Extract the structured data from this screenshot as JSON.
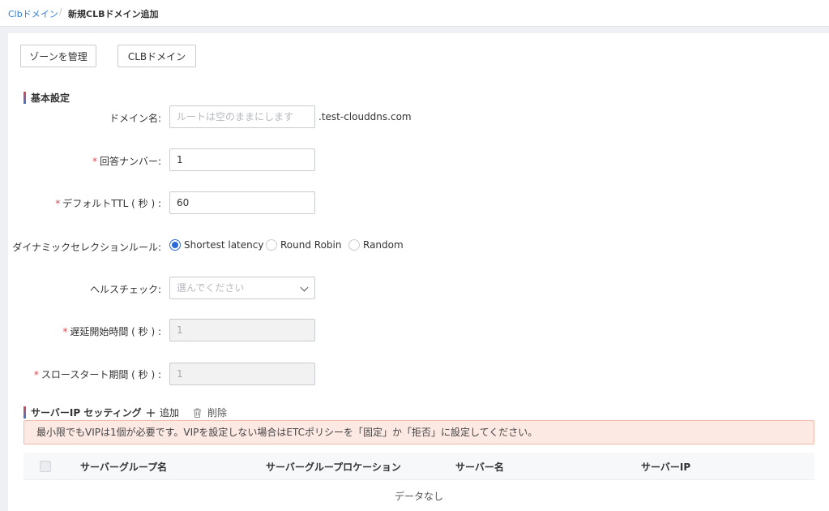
{
  "breadcrumb": {
    "parent": "Clbドメイン",
    "separator": "/",
    "current": "新規CLBドメイン追加"
  },
  "top_buttons": {
    "manage_zone": "ゾーンを管理",
    "clb_domain": "CLBドメイン"
  },
  "basic_settings": {
    "title": "基本設定",
    "domain_name": {
      "label": "ドメイン名:",
      "placeholder": "ルートは空のままにします",
      "value": "",
      "suffix": ".test-clouddns.com"
    },
    "answer_number": {
      "required": "*",
      "label": "回答ナンバー:",
      "value": "1"
    },
    "default_ttl": {
      "required": "*",
      "label": "デフォルトTTL ( 秒 ) :",
      "value": "60"
    },
    "dynamic_rule": {
      "label": "ダイナミックセレクションルール:",
      "options": [
        "Shortest latency",
        "Round Robin",
        "Random"
      ],
      "selected": "Shortest latency"
    },
    "health_check": {
      "label": "ヘルスチェック:",
      "placeholder": "選んでください"
    },
    "delay_start": {
      "required": "*",
      "label": "遅延開始時間 ( 秒 ) :",
      "value": "1"
    },
    "slow_start": {
      "required": "*",
      "label": "スロースタート期間 ( 秒 ) :",
      "value": "1"
    }
  },
  "server_ip": {
    "title": "サーバーIP セッティング",
    "add_label": "追加",
    "delete_label": "削除",
    "alert": "最小限でもVIPは1個が必要です。VIPを設定しない場合はETCポリシーを「固定」か「拒否」に設定してください。",
    "columns": [
      "サーバーグループ名",
      "サーバーグループロケーション",
      "サーバー名",
      "サーバーIP"
    ],
    "empty_text": "データなし"
  },
  "colors": {
    "accent": "#2d6ad8",
    "required": "#e0474e",
    "alert_bg": "#fde9e3",
    "alert_border": "#f1b9a8"
  }
}
